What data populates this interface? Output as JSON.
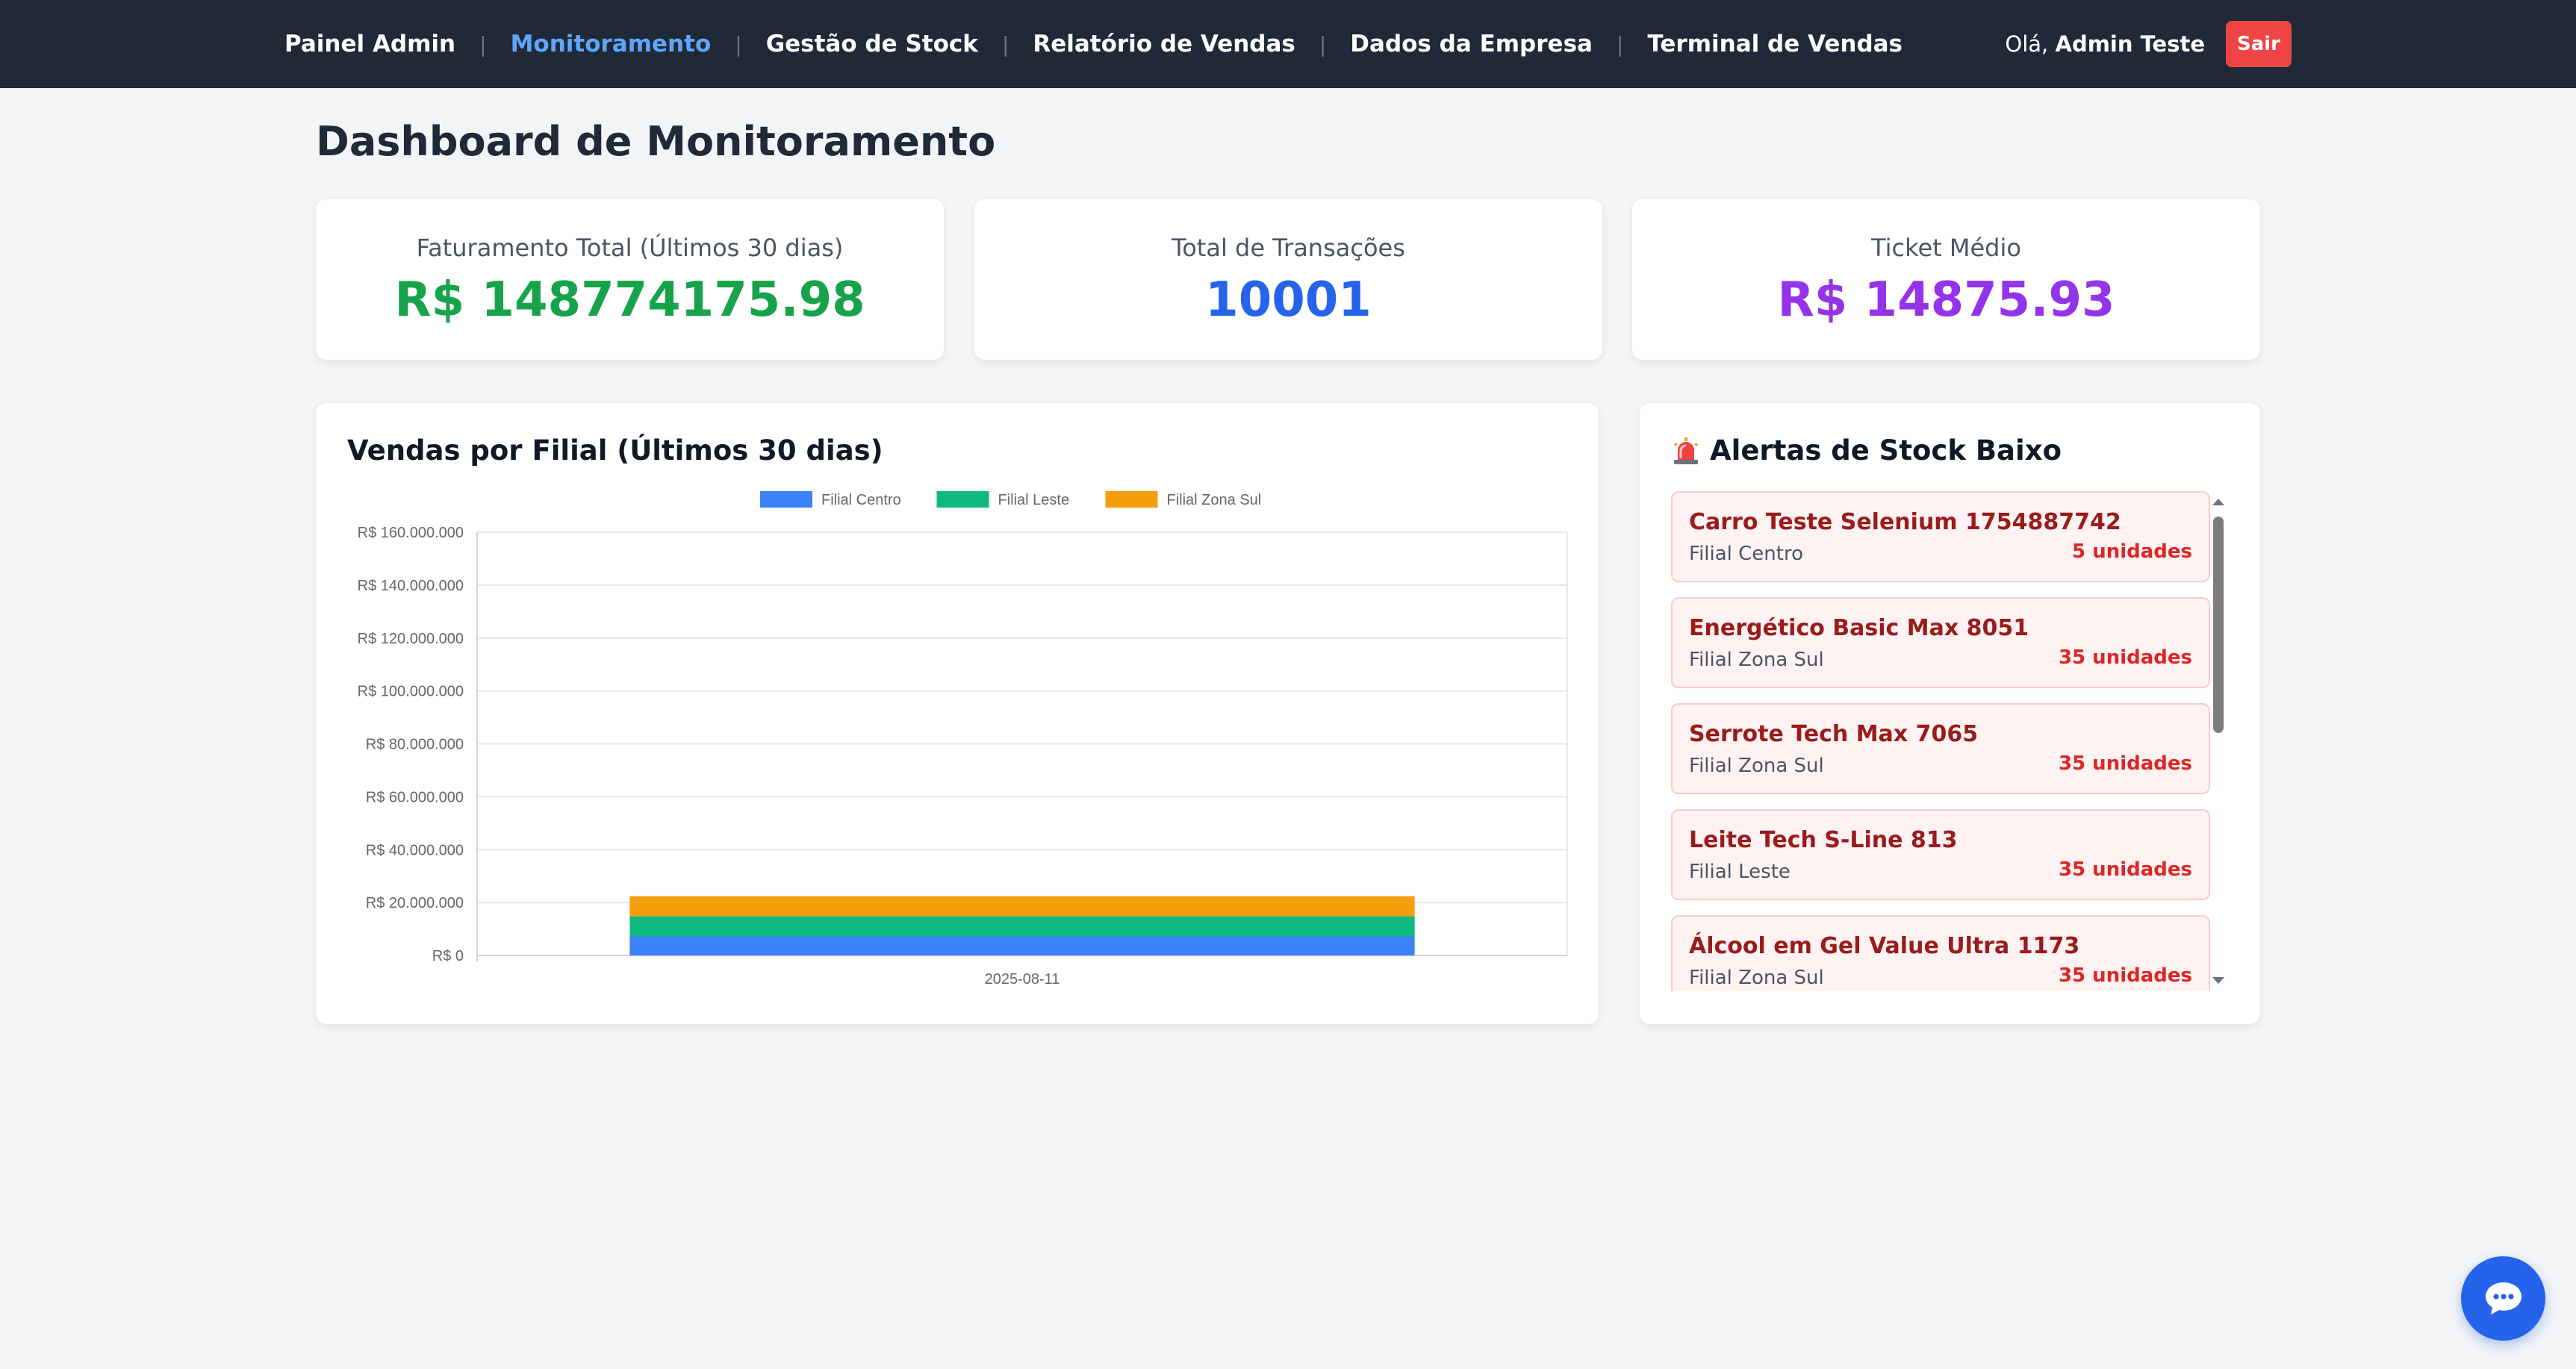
{
  "nav": {
    "links": [
      {
        "label": "Painel Admin",
        "active": false
      },
      {
        "label": "Monitoramento",
        "active": true
      },
      {
        "label": "Gestão de Stock",
        "active": false
      },
      {
        "label": "Relatório de Vendas",
        "active": false
      },
      {
        "label": "Dados da Empresa",
        "active": false
      },
      {
        "label": "Terminal de Vendas",
        "active": false
      }
    ],
    "separator": "|",
    "greeting_prefix": "Olá,",
    "user_name": "Admin Teste",
    "logout_label": "Sair"
  },
  "page": {
    "title": "Dashboard de Monitoramento"
  },
  "kpis": [
    {
      "label": "Faturamento Total (Últimos 30 dias)",
      "value": "R$ 148774175.98",
      "color": "#16a34a"
    },
    {
      "label": "Total de Transações",
      "value": "10001",
      "color": "#2563eb"
    },
    {
      "label": "Ticket Médio",
      "value": "R$ 14875.93",
      "color": "#9333ea"
    }
  ],
  "sales_chart": {
    "title": "Vendas por Filial (Últimos 30 dias)"
  },
  "chart_data": {
    "type": "bar",
    "stacked": true,
    "title": "",
    "xlabel": "",
    "ylabel": "",
    "categories": [
      "2025-08-11"
    ],
    "series": [
      {
        "name": "Filial Centro",
        "color": "#3b82f6",
        "values": [
          7200000
        ]
      },
      {
        "name": "Filial Leste",
        "color": "#10b981",
        "values": [
          7600000
        ]
      },
      {
        "name": "Filial Zona Sul",
        "color": "#f59e0b",
        "values": [
          7600000
        ]
      }
    ],
    "ylim": [
      0,
      160000000
    ],
    "yticks": [
      "R$ 160.000.000",
      "R$ 140.000.000",
      "R$ 120.000.000",
      "R$ 100.000.000",
      "R$ 80.000.000",
      "R$ 60.000.000",
      "R$ 40.000.000",
      "R$ 20.000.000",
      "R$ 0"
    ],
    "ytick_values": [
      160000000,
      140000000,
      120000000,
      100000000,
      80000000,
      60000000,
      40000000,
      20000000,
      0
    ],
    "legend_position": "top-center",
    "grid": true
  },
  "alerts": {
    "title": "Alertas de Stock Baixo",
    "icon": "siren-icon",
    "items": [
      {
        "name": "Carro Teste Selenium 1754887742",
        "branch": "Filial Centro",
        "qty": "5 unidades"
      },
      {
        "name": "Energético Basic Max 8051",
        "branch": "Filial Zona Sul",
        "qty": "35 unidades"
      },
      {
        "name": "Serrote Tech Max 7065",
        "branch": "Filial Zona Sul",
        "qty": "35 unidades"
      },
      {
        "name": "Leite Tech S-Line 813",
        "branch": "Filial Leste",
        "qty": "35 unidades"
      },
      {
        "name": "Álcool em Gel Value Ultra 1173",
        "branch": "Filial Zona Sul",
        "qty": "35 unidades"
      }
    ]
  },
  "chat": {
    "icon": "chat-bubble-icon"
  }
}
